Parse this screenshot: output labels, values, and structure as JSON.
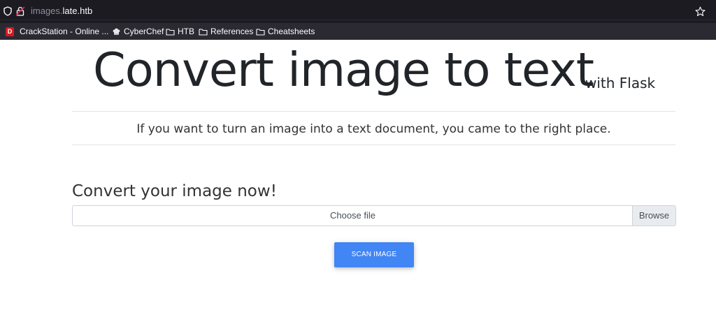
{
  "browser": {
    "url_subdomain": "images.",
    "url_domain": "late.htb",
    "bookmarks": [
      {
        "label": "CrackStation - Online ...",
        "icon": "crackstation-icon"
      },
      {
        "label": "CyberChef",
        "icon": "cyberchef-icon"
      },
      {
        "label": "HTB",
        "icon": "folder-icon"
      },
      {
        "label": "References",
        "icon": "folder-icon"
      },
      {
        "label": "Cheatsheets",
        "icon": "folder-icon"
      }
    ]
  },
  "page": {
    "title": "Convert image to text",
    "title_suffix": "with Flask",
    "lead": "If you want to turn an image into a text document, you came to the right place.",
    "section_title": "Convert your image now!",
    "file_input": {
      "label": "Choose file",
      "browse_label": "Browse"
    },
    "scan_button": "SCAN IMAGE"
  },
  "colors": {
    "chrome_bg": "#1c1b22",
    "bookmarks_bg": "#2b2a33",
    "button_primary": "#4285f4",
    "text_dark": "#212529"
  }
}
